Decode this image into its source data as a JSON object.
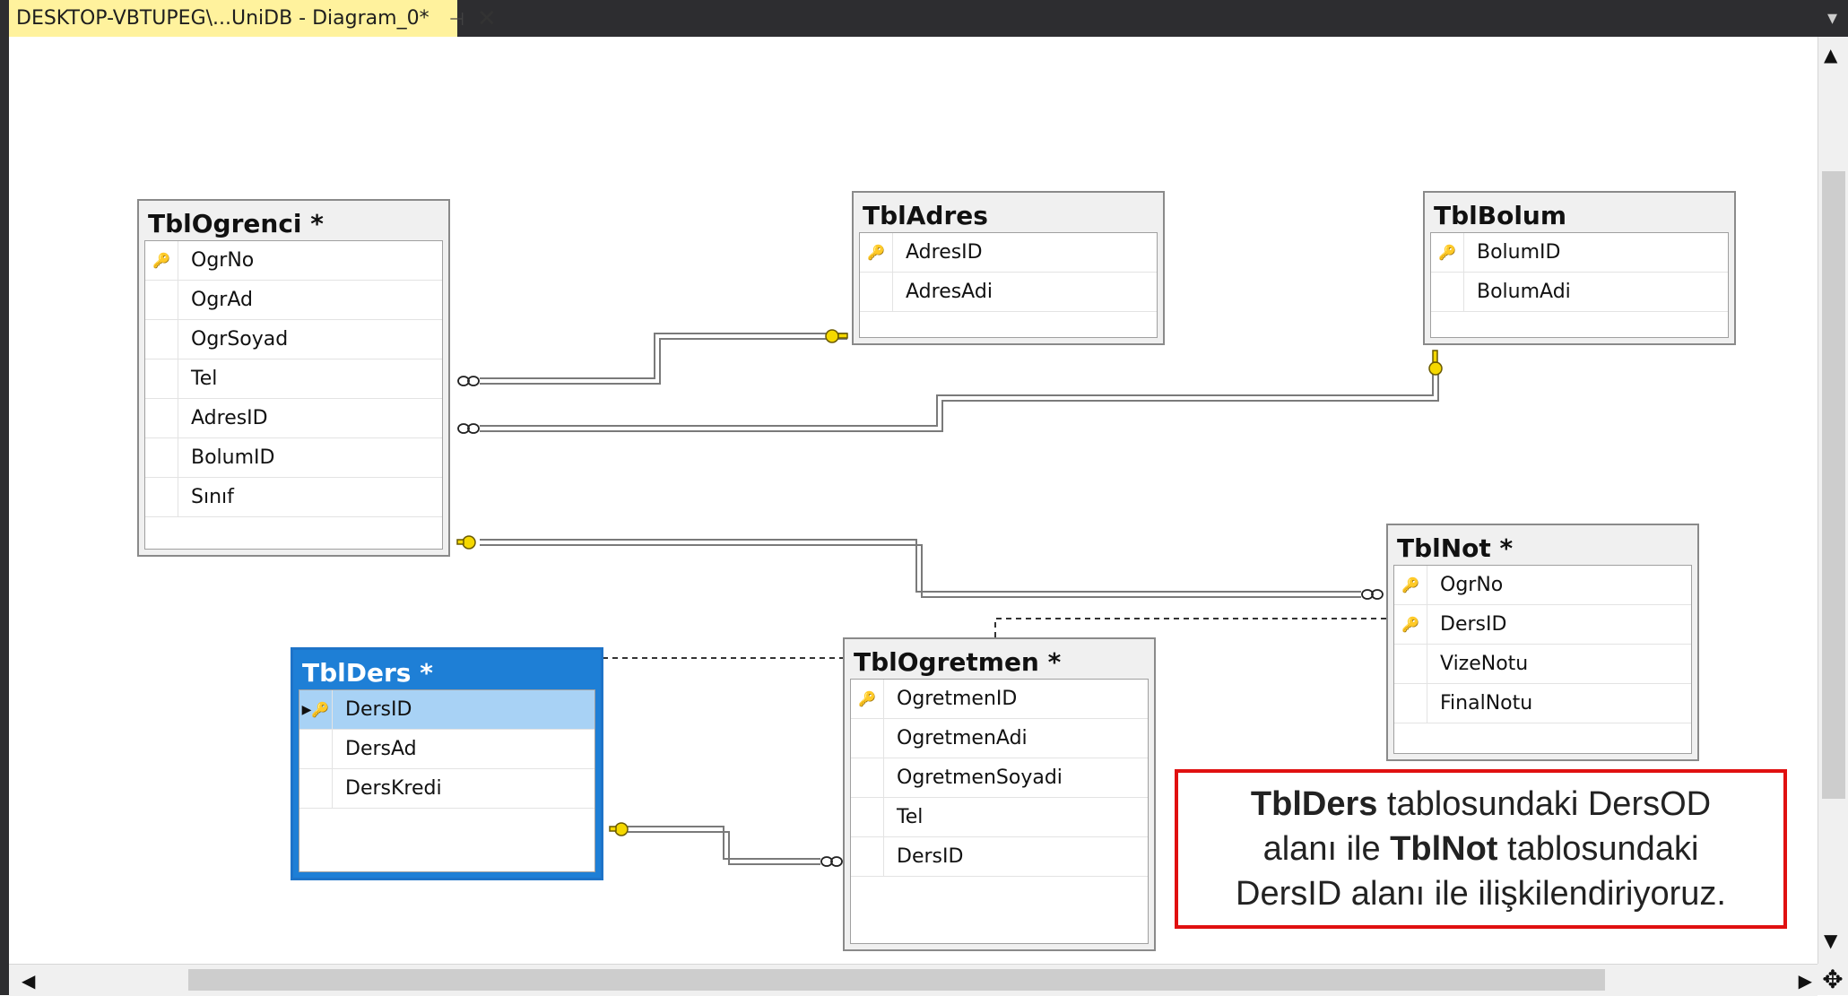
{
  "tab": {
    "title": "DESKTOP-VBTUPEG\\...UniDB - Diagram_0*",
    "pin_icon": "pin-icon",
    "close_icon": "close-icon"
  },
  "tables": {
    "ogrenci": {
      "title": "TblOgrenci *",
      "columns": [
        {
          "name": "OgrNo",
          "key": true
        },
        {
          "name": "OgrAd",
          "key": false
        },
        {
          "name": "OgrSoyad",
          "key": false
        },
        {
          "name": "Tel",
          "key": false
        },
        {
          "name": "AdresID",
          "key": false
        },
        {
          "name": "BolumID",
          "key": false
        },
        {
          "name": "Sınıf",
          "key": false
        }
      ]
    },
    "adres": {
      "title": "TblAdres",
      "columns": [
        {
          "name": "AdresID",
          "key": true
        },
        {
          "name": "AdresAdi",
          "key": false
        }
      ]
    },
    "bolum": {
      "title": "TblBolum",
      "columns": [
        {
          "name": "BolumID",
          "key": true
        },
        {
          "name": "BolumAdi",
          "key": false
        }
      ]
    },
    "not": {
      "title": "TblNot *",
      "columns": [
        {
          "name": "OgrNo",
          "key": true
        },
        {
          "name": "DersID",
          "key": true
        },
        {
          "name": "VizeNotu",
          "key": false
        },
        {
          "name": "FinalNotu",
          "key": false
        }
      ]
    },
    "ders": {
      "title": "TblDers *",
      "columns": [
        {
          "name": "DersID",
          "key": true
        },
        {
          "name": "DersAd",
          "key": false
        },
        {
          "name": "DersKredi",
          "key": false
        }
      ]
    },
    "ogretmen": {
      "title": "TblOgretmen *",
      "columns": [
        {
          "name": "OgretmenID",
          "key": true
        },
        {
          "name": "OgretmenAdi",
          "key": false
        },
        {
          "name": "OgretmenSoyadi",
          "key": false
        },
        {
          "name": "Tel",
          "key": false
        },
        {
          "name": "DersID",
          "key": false
        }
      ]
    }
  },
  "callout": {
    "line1_bold": "TblDers",
    "line1_rest": " tablosundaki DersOD",
    "line2_pre": "alanı ile ",
    "line2_bold": "TblNot",
    "line2_rest": " tablosundaki",
    "line3": "DersID alanı ile ilişkilendiriyoruz."
  },
  "colors": {
    "tab_bg": "#fff29d",
    "chrome": "#2d2d30",
    "selected_table": "#1e7fd6",
    "callout_border": "#e01010",
    "key_icon": "#c8a100"
  }
}
